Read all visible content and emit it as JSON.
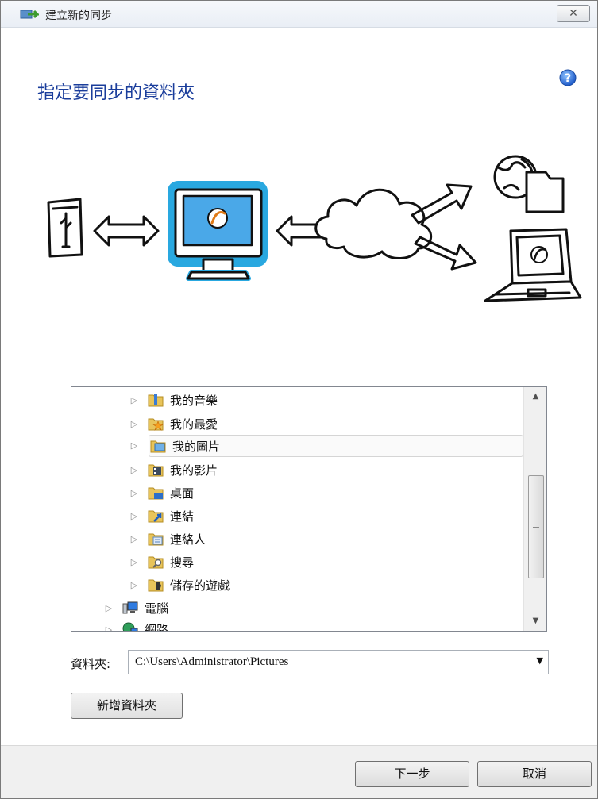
{
  "window": {
    "title": "建立新的同步",
    "close_label": "✕"
  },
  "page": {
    "heading": "指定要同步的資料夾"
  },
  "tree": {
    "items": [
      {
        "label": "我的音樂",
        "icon": "music-folder-icon"
      },
      {
        "label": "我的最愛",
        "icon": "favorites-folder-icon"
      },
      {
        "label": "我的圖片",
        "icon": "pictures-folder-icon"
      },
      {
        "label": "我的影片",
        "icon": "videos-folder-icon"
      },
      {
        "label": "桌面",
        "icon": "desktop-folder-icon"
      },
      {
        "label": "連結",
        "icon": "links-folder-icon"
      },
      {
        "label": "連絡人",
        "icon": "contacts-folder-icon"
      },
      {
        "label": "搜尋",
        "icon": "searches-folder-icon"
      },
      {
        "label": "儲存的遊戲",
        "icon": "saved-games-folder-icon"
      },
      {
        "label": "電腦",
        "icon": "computer-icon"
      },
      {
        "label": "網路",
        "icon": "network-icon"
      }
    ],
    "selected_label": "我的圖片"
  },
  "folder": {
    "label": "資料夾:",
    "path": "C:\\Users\\Administrator\\Pictures"
  },
  "buttons": {
    "new_folder": "新增資料夾",
    "next": "下一步",
    "cancel": "取消"
  },
  "colors": {
    "heading": "#1a3d9b",
    "monitor_highlight": "#29a8e0"
  }
}
